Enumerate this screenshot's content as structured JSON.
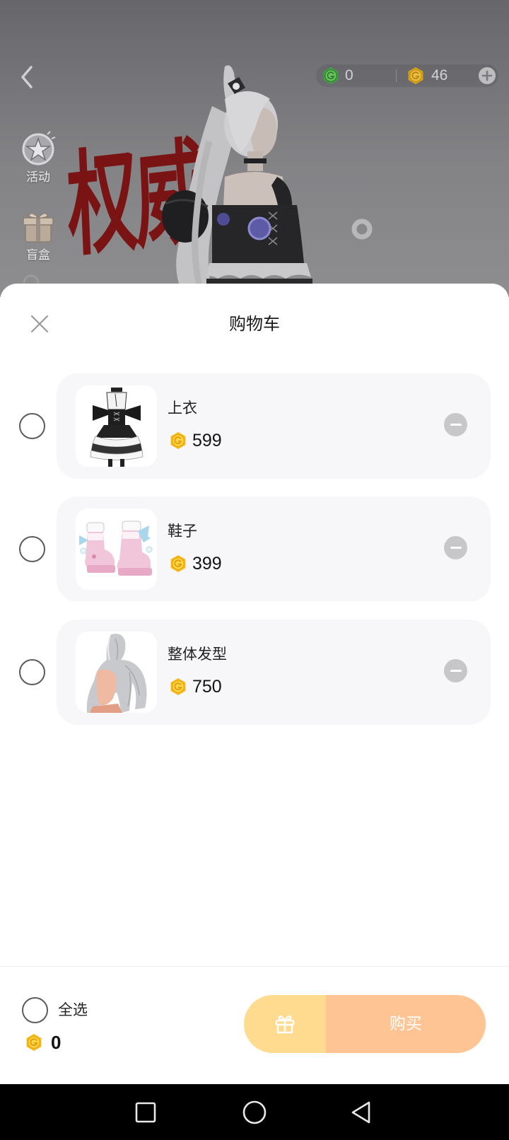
{
  "top_bar": {
    "back_icon": "chevron-left-icon",
    "gems": {
      "icon": "green-coin-icon",
      "value": "0",
      "color": "#3f9f43"
    },
    "coins": {
      "icon": "gold-coin-icon",
      "value": "46",
      "color": "#f6b91a"
    },
    "add_icon": "plus-circle-icon"
  },
  "side_menu": [
    {
      "label": "活动",
      "icon": "star-badge-icon"
    },
    {
      "label": "盲盒",
      "icon": "gift-box-icon"
    }
  ],
  "banner": {
    "text": "权威",
    "color": "#7a1414"
  },
  "cart": {
    "title": "购物车",
    "close_icon": "close-icon",
    "items": [
      {
        "name": "上衣",
        "price": "599",
        "currency_icon": "gold-coin-icon",
        "thumbnail_icon": "maid-dress-icon",
        "selected": false,
        "remove_icon": "minus-circle-icon"
      },
      {
        "name": "鞋子",
        "price": "399",
        "currency_icon": "gold-coin-icon",
        "thumbnail_icon": "pink-shoes-icon",
        "selected": false,
        "remove_icon": "minus-circle-icon"
      },
      {
        "name": "整体发型",
        "price": "750",
        "currency_icon": "gold-coin-icon",
        "thumbnail_icon": "silver-ponytail-icon",
        "selected": false,
        "remove_icon": "minus-circle-icon"
      }
    ],
    "footer": {
      "select_all_label": "全选",
      "select_all_checked": false,
      "total": "0",
      "gift_icon": "gift-icon",
      "buy_label": "购买"
    }
  },
  "colors": {
    "card_bg": "#f7f7f9",
    "gift_button": "#fedb8f",
    "buy_button": "#ffc494",
    "remove_button": "#c7c7ca",
    "scene_dim": "#7f7f82"
  },
  "system_nav": {
    "recents_icon": "square-icon",
    "home_icon": "circle-icon",
    "back_icon": "triangle-back-icon"
  }
}
